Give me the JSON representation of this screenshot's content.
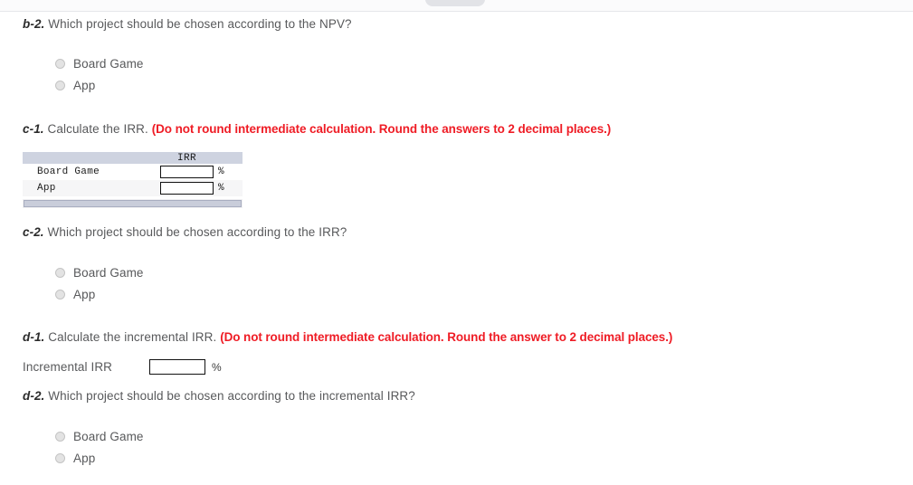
{
  "page": {
    "background": "#ffffff",
    "text_color": "#58595b",
    "accent_red": "#ef1c25"
  },
  "top_bar": {
    "pill_name": "scroll-handle-pill"
  },
  "questions": {
    "b2": {
      "label": "b-2.",
      "text": "Which project should be chosen according to the NPV?",
      "options": [
        {
          "label": "Board Game"
        },
        {
          "label": "App"
        }
      ]
    },
    "c1": {
      "label": "c-1.",
      "text": "Calculate the IRR.",
      "note": "(Do not round intermediate calculation. Round the answers to 2 decimal places.)",
      "table": {
        "columns": [
          "",
          "IRR",
          ""
        ],
        "rows": [
          {
            "name": "Board Game",
            "value": "",
            "unit": "%"
          },
          {
            "name": "App",
            "value": "",
            "unit": "%"
          }
        ]
      }
    },
    "c2": {
      "label": "c-2.",
      "text": "Which project should be chosen according to the IRR?",
      "options": [
        {
          "label": "Board Game"
        },
        {
          "label": "App"
        }
      ]
    },
    "d1": {
      "label": "d-1.",
      "text": "Calculate the incremental IRR.",
      "note": "(Do not round intermediate calculation. Round the answer to 2 decimal places.)",
      "field": {
        "label": "Incremental IRR",
        "value": "",
        "unit": "%"
      }
    },
    "d2": {
      "label": "d-2.",
      "text": "Which project should be chosen according to the incremental IRR?",
      "options": [
        {
          "label": "Board Game"
        },
        {
          "label": "App"
        }
      ]
    }
  }
}
